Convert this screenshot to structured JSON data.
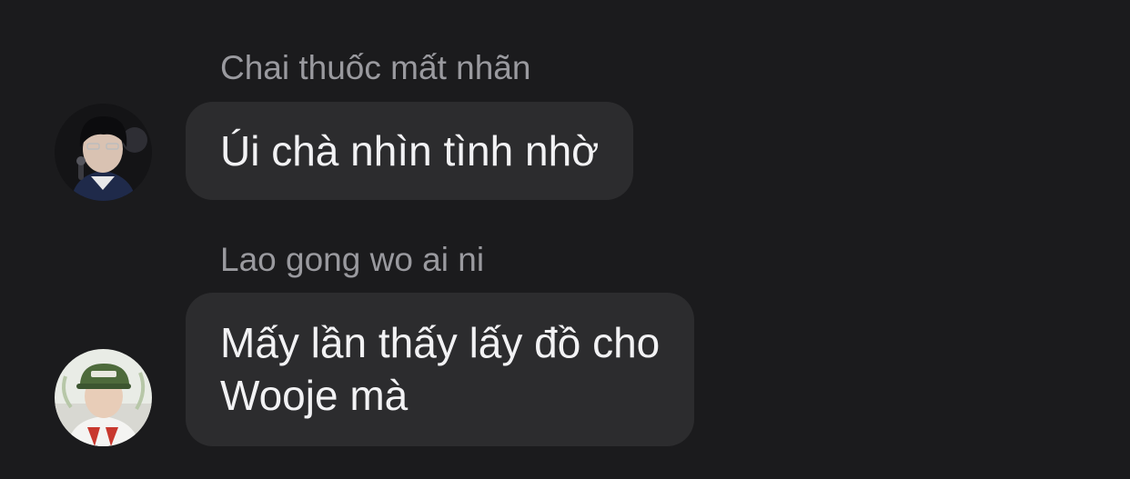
{
  "messages": [
    {
      "sender": "Chai thuốc mất nhãn",
      "lines": [
        "Úi chà nhìn tình nhờ"
      ],
      "avatar_icon": "user-avatar-dark-hair"
    },
    {
      "sender": "Lao gong wo ai ni",
      "lines": [
        "Mấy lần thấy lấy đồ cho",
        "Wooje mà"
      ],
      "avatar_icon": "user-avatar-green-cap"
    }
  ]
}
